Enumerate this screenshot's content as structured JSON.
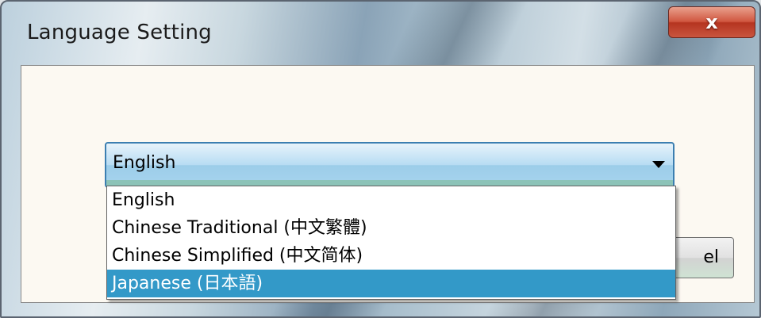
{
  "window": {
    "title": "Language Setting",
    "close_label": "x"
  },
  "combo": {
    "selected": "English"
  },
  "dropdown": {
    "options": [
      "English",
      "Chinese Traditional (中文繁體)",
      "Chinese Simplified (中文简体)",
      "Japanese (日本語)"
    ],
    "highlighted_index": 3
  },
  "buttons": {
    "cancel_visible_fragment": "el"
  },
  "colors": {
    "highlight": "#3399c8",
    "close_button": "#c9553e",
    "client_background": "#fcf9f2"
  }
}
